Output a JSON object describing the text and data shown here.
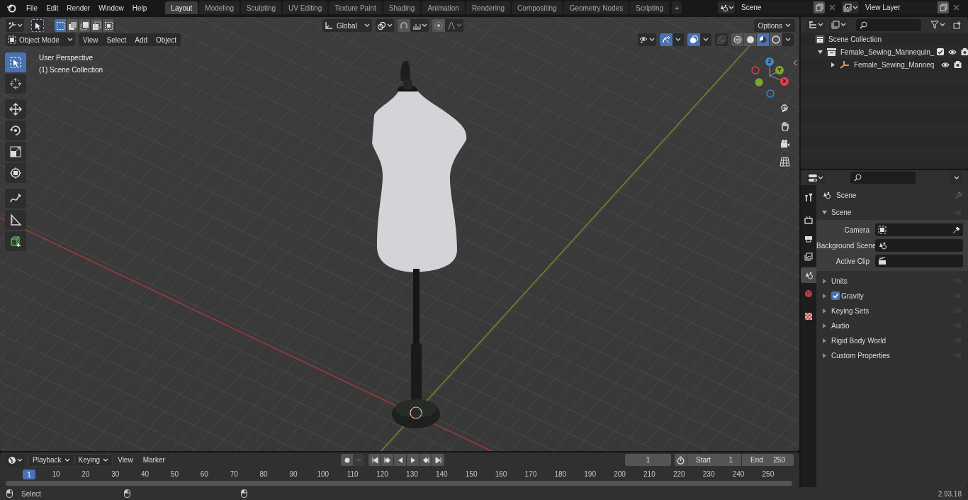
{
  "top_menu": [
    "File",
    "Edit",
    "Render",
    "Window",
    "Help"
  ],
  "workspace_tabs": [
    {
      "label": "Layout",
      "selected": true
    },
    {
      "label": "Modeling",
      "selected": false
    },
    {
      "label": "Sculpting",
      "selected": false
    },
    {
      "label": "UV Editing",
      "selected": false
    },
    {
      "label": "Texture Paint",
      "selected": false
    },
    {
      "label": "Shading",
      "selected": false
    },
    {
      "label": "Animation",
      "selected": false
    },
    {
      "label": "Rendering",
      "selected": false
    },
    {
      "label": "Compositing",
      "selected": false
    },
    {
      "label": "Geometry Nodes",
      "selected": false
    },
    {
      "label": "Scripting",
      "selected": false
    },
    {
      "label": "+",
      "selected": false
    }
  ],
  "scene_field": {
    "value": "Scene"
  },
  "view_layer_field": {
    "value": "View Layer"
  },
  "viewport": {
    "select_modes": [
      {
        "selected": true
      },
      {
        "selected": false
      },
      {
        "selected": false
      },
      {
        "selected": false
      },
      {
        "selected": false
      }
    ],
    "transform_orientation": "Global",
    "options_button": "Options",
    "mode": "Object Mode",
    "menus": [
      "View",
      "Select",
      "Add",
      "Object"
    ],
    "gizmos_on": true,
    "overlays_on": true,
    "xray_on": false,
    "shading_modes": [
      {
        "selected": false
      },
      {
        "selected": false
      },
      {
        "selected": true
      },
      {
        "selected": false
      }
    ],
    "tools": [
      {
        "kind": "select",
        "selected": true
      },
      {
        "kind": "cursor",
        "selected": false
      },
      {
        "kind": "move",
        "selected": false
      },
      {
        "kind": "rotate",
        "selected": false
      },
      {
        "kind": "scale",
        "selected": false
      },
      {
        "kind": "transform",
        "selected": false
      },
      {
        "kind": "annotate",
        "selected": false
      },
      {
        "kind": "measure",
        "selected": false
      },
      {
        "kind": "add_cube",
        "selected": false
      }
    ],
    "overlay_text": [
      "User Perspective",
      "(1) Scene Collection"
    ],
    "gizmo_axes": [
      "X",
      "Y",
      "Z"
    ]
  },
  "outliner": {
    "root": "Scene Collection",
    "items": [
      {
        "label": "Female_Sewing_Mannequin_",
        "kind": "collection",
        "expanded": true,
        "checked": true,
        "children": [
          {
            "label": "Female_Sewing_Manneq",
            "kind": "object",
            "expanded": false
          }
        ]
      }
    ]
  },
  "properties": {
    "context": "Scene",
    "tabs": [
      {
        "kind": "tool",
        "selected": false
      },
      {
        "kind": "render",
        "selected": false
      },
      {
        "kind": "output",
        "selected": false
      },
      {
        "kind": "view_layer",
        "selected": false
      },
      {
        "kind": "scene",
        "selected": true
      },
      {
        "kind": "world",
        "selected": false
      },
      {
        "kind": "texture",
        "selected": false
      }
    ],
    "panel": {
      "title": "Scene",
      "expanded": true,
      "fields": [
        {
          "label": "Camera",
          "kind": "camera"
        },
        {
          "label": "Background Scene",
          "kind": "scene"
        },
        {
          "label": "Active Clip",
          "kind": "clip"
        }
      ]
    },
    "sections": [
      {
        "label": "Units",
        "expanded": false,
        "kind": "plain"
      },
      {
        "label": "Gravity",
        "expanded": false,
        "kind": "checkbox",
        "checked": true
      },
      {
        "label": "Keying Sets",
        "expanded": false,
        "kind": "plain"
      },
      {
        "label": "Audio",
        "expanded": false,
        "kind": "plain"
      },
      {
        "label": "Rigid Body World",
        "expanded": false,
        "kind": "plain"
      },
      {
        "label": "Custom Properties",
        "expanded": false,
        "kind": "plain"
      }
    ]
  },
  "timeline": {
    "menus": [
      {
        "label": "Playback",
        "kind": "dropdown"
      },
      {
        "label": "Keying",
        "kind": "dropdown"
      },
      {
        "label": "View",
        "kind": "menu"
      },
      {
        "label": "Marker",
        "kind": "menu"
      }
    ],
    "current_frame": "1",
    "start_label": "Start",
    "start": "1",
    "end_label": "End",
    "end": "250",
    "playhead": "1",
    "ruler": [
      "10",
      "20",
      "30",
      "40",
      "50",
      "60",
      "70",
      "80",
      "90",
      "100",
      "110",
      "120",
      "130",
      "140",
      "150",
      "160",
      "170",
      "180",
      "190",
      "200",
      "210",
      "220",
      "230",
      "240",
      "250"
    ]
  },
  "status_bar": {
    "hint": "Select",
    "version": "2.93.18"
  }
}
